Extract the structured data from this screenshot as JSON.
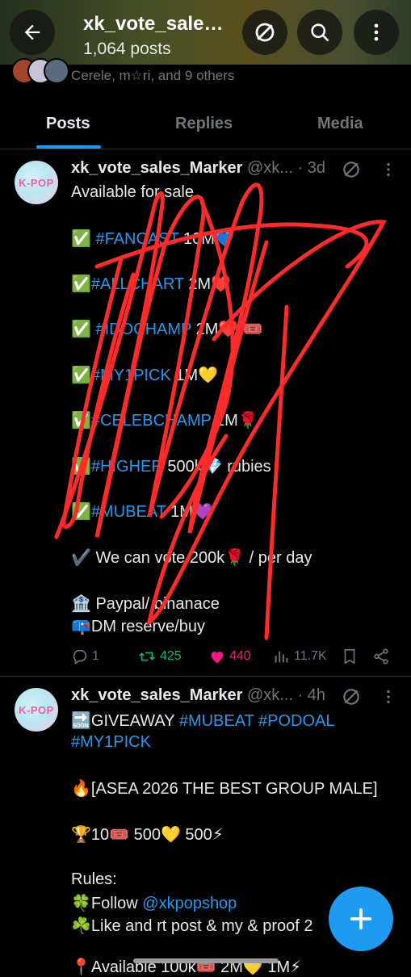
{
  "header": {
    "title": "xk_vote_sales_Marker",
    "post_count": "1,064 posts",
    "followed_by": "Cerele, m☆ri, and 9 others",
    "back_icon": "arrow-left-icon",
    "grok_icon": "slash-circle-icon",
    "search_icon": "search-icon",
    "more_icon": "more-vertical-icon"
  },
  "tabs": [
    {
      "label": "Posts",
      "active": true
    },
    {
      "label": "Replies",
      "active": false
    },
    {
      "label": "Media",
      "active": false
    }
  ],
  "tweets": [
    {
      "name": "xk_vote_sales_Marker",
      "handle": "@xk...",
      "time": "· 3d",
      "avatar_text": "K-POP",
      "lines": [
        {
          "text": "Available for sale"
        },
        {
          "pre": "✅ ",
          "tag": "#FANCAST",
          "post": " 10M💙"
        },
        {
          "pre": "✅",
          "tag": "#ALLCHART",
          "post": "  2M❤️"
        },
        {
          "pre": "✅ ",
          "tag": "#IDOCHAMP",
          "post": " 2M❤️/🎟️"
        },
        {
          "pre": "✅",
          "tag": "#MY1PICK",
          "post": " 1M💛"
        },
        {
          "pre": "✅",
          "tag": "#CELEBCHAMP",
          "post": " 1M🌹"
        },
        {
          "pre": "✅",
          "tag": "#HIGHER",
          "post": " 500k💎 rubies"
        },
        {
          "pre": "✅",
          "tag": "#MUBEAT",
          "post": " 1M💜"
        },
        {
          "text": "✔️ We can vote 200k🌹 / per day"
        },
        {
          "text": "🏦 Paypal/ binanace"
        },
        {
          "text": "📪DM reserve/buy"
        }
      ],
      "stats": {
        "replies": "1",
        "reposts": "425",
        "likes": "440",
        "views": "11.7K"
      }
    },
    {
      "name": "xk_vote_sales_Marker",
      "handle": "@xk...",
      "time": "· 4h",
      "avatar_text": "K-POP",
      "lines": [
        {
          "pre": "🔜GIVEAWAY ",
          "tag": "#MUBEAT #PODOAL",
          "post": ""
        },
        {
          "pre": "",
          "tag": "#MY1PICK",
          "post": ""
        },
        {
          "text": "🔥[ASEA 2026 THE BEST GROUP MALE]"
        },
        {
          "text": "🏆10🎟️ 500💛 500⚡"
        },
        {
          "text": "Rules:"
        },
        {
          "pre": "🍀Follow ",
          "tag": "@xkpopshop",
          "post": ""
        },
        {
          "text": "☘️Like and rt post & my & proof 2"
        },
        {
          "text": "📍Available 100k🎟️ 2M💛 1M⚡"
        }
      ]
    }
  ],
  "fab": {
    "icon": "plus-icon"
  },
  "colors": {
    "accent": "#1d9bf0",
    "repost": "#00ba7c",
    "like": "#f91880",
    "scribble": "#ff2a2a"
  }
}
